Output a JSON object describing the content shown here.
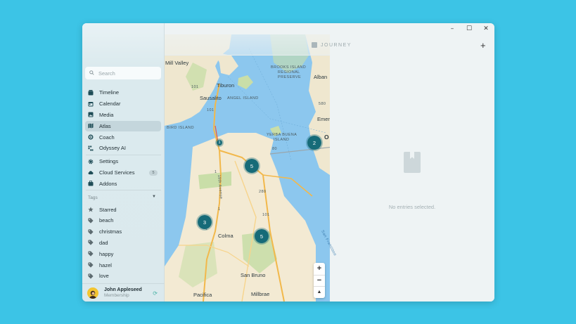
{
  "window_controls": {
    "minimize": "–",
    "maximize": "☐",
    "close": "✕"
  },
  "search": {
    "placeholder": "Search"
  },
  "nav_main": [
    {
      "label": "Timeline",
      "icon": "timeline-icon"
    },
    {
      "label": "Calendar",
      "icon": "calendar-icon"
    },
    {
      "label": "Media",
      "icon": "media-icon"
    },
    {
      "label": "Atlas",
      "icon": "atlas-icon",
      "active": true
    },
    {
      "label": "Coach",
      "icon": "coach-icon"
    },
    {
      "label": "Odyssey AI",
      "icon": "ai-icon"
    }
  ],
  "nav_secondary": [
    {
      "label": "Settings",
      "icon": "gear-icon"
    },
    {
      "label": "Cloud Services",
      "icon": "cloud-icon",
      "badge": "5"
    },
    {
      "label": "Addons",
      "icon": "addons-icon"
    }
  ],
  "tags": {
    "header": "Tags",
    "items": [
      "Starred",
      "beach",
      "christmas",
      "dad",
      "happy",
      "hazel",
      "love"
    ]
  },
  "user": {
    "name": "John Appleseed",
    "subtitle": "Membership"
  },
  "header": {
    "journal": "JOURNEY",
    "add": "+"
  },
  "map": {
    "labels": {
      "mill_valley": "Mill Valley",
      "tiburon": "Tiburon",
      "sausalito": "Sausalito",
      "angel_island": "ANGEL ISLAND",
      "bird_island": "BIRD ISLAND",
      "brooks_1": "BROOKS ISLAND",
      "brooks_2": "REGIONAL",
      "brooks_3": "PRESERVE",
      "albany": "Alban",
      "emeryville": "Emer",
      "oakland": "O",
      "yerba_1": "YERBA BUENA",
      "yerba_2": "ISLAND",
      "colma": "Colma",
      "san_bruno": "San Bruno",
      "pacifica": "Pacifica",
      "millbrae": "Millbrae",
      "sf_bay": "San Francisco",
      "hw101_a": "101",
      "hw101_b": "101",
      "hw101_c": "101",
      "hw1_a": "1",
      "hw1_b": "1",
      "hw1_c": "1",
      "i80": "80",
      "i280": "280",
      "i580": "580",
      "avenue": "19th Avenue"
    },
    "clusters": [
      {
        "count": "1"
      },
      {
        "count": "5"
      },
      {
        "count": "2"
      },
      {
        "count": "3"
      },
      {
        "count": "5"
      }
    ],
    "zoom": {
      "in": "+",
      "out": "−",
      "north": "▲"
    }
  },
  "empty_state": {
    "text": "No entries selected."
  },
  "colors": {
    "background": "#3cc4e6",
    "cluster": "#166b78",
    "water": "#8cc7ee",
    "land": "#f3ead3"
  }
}
